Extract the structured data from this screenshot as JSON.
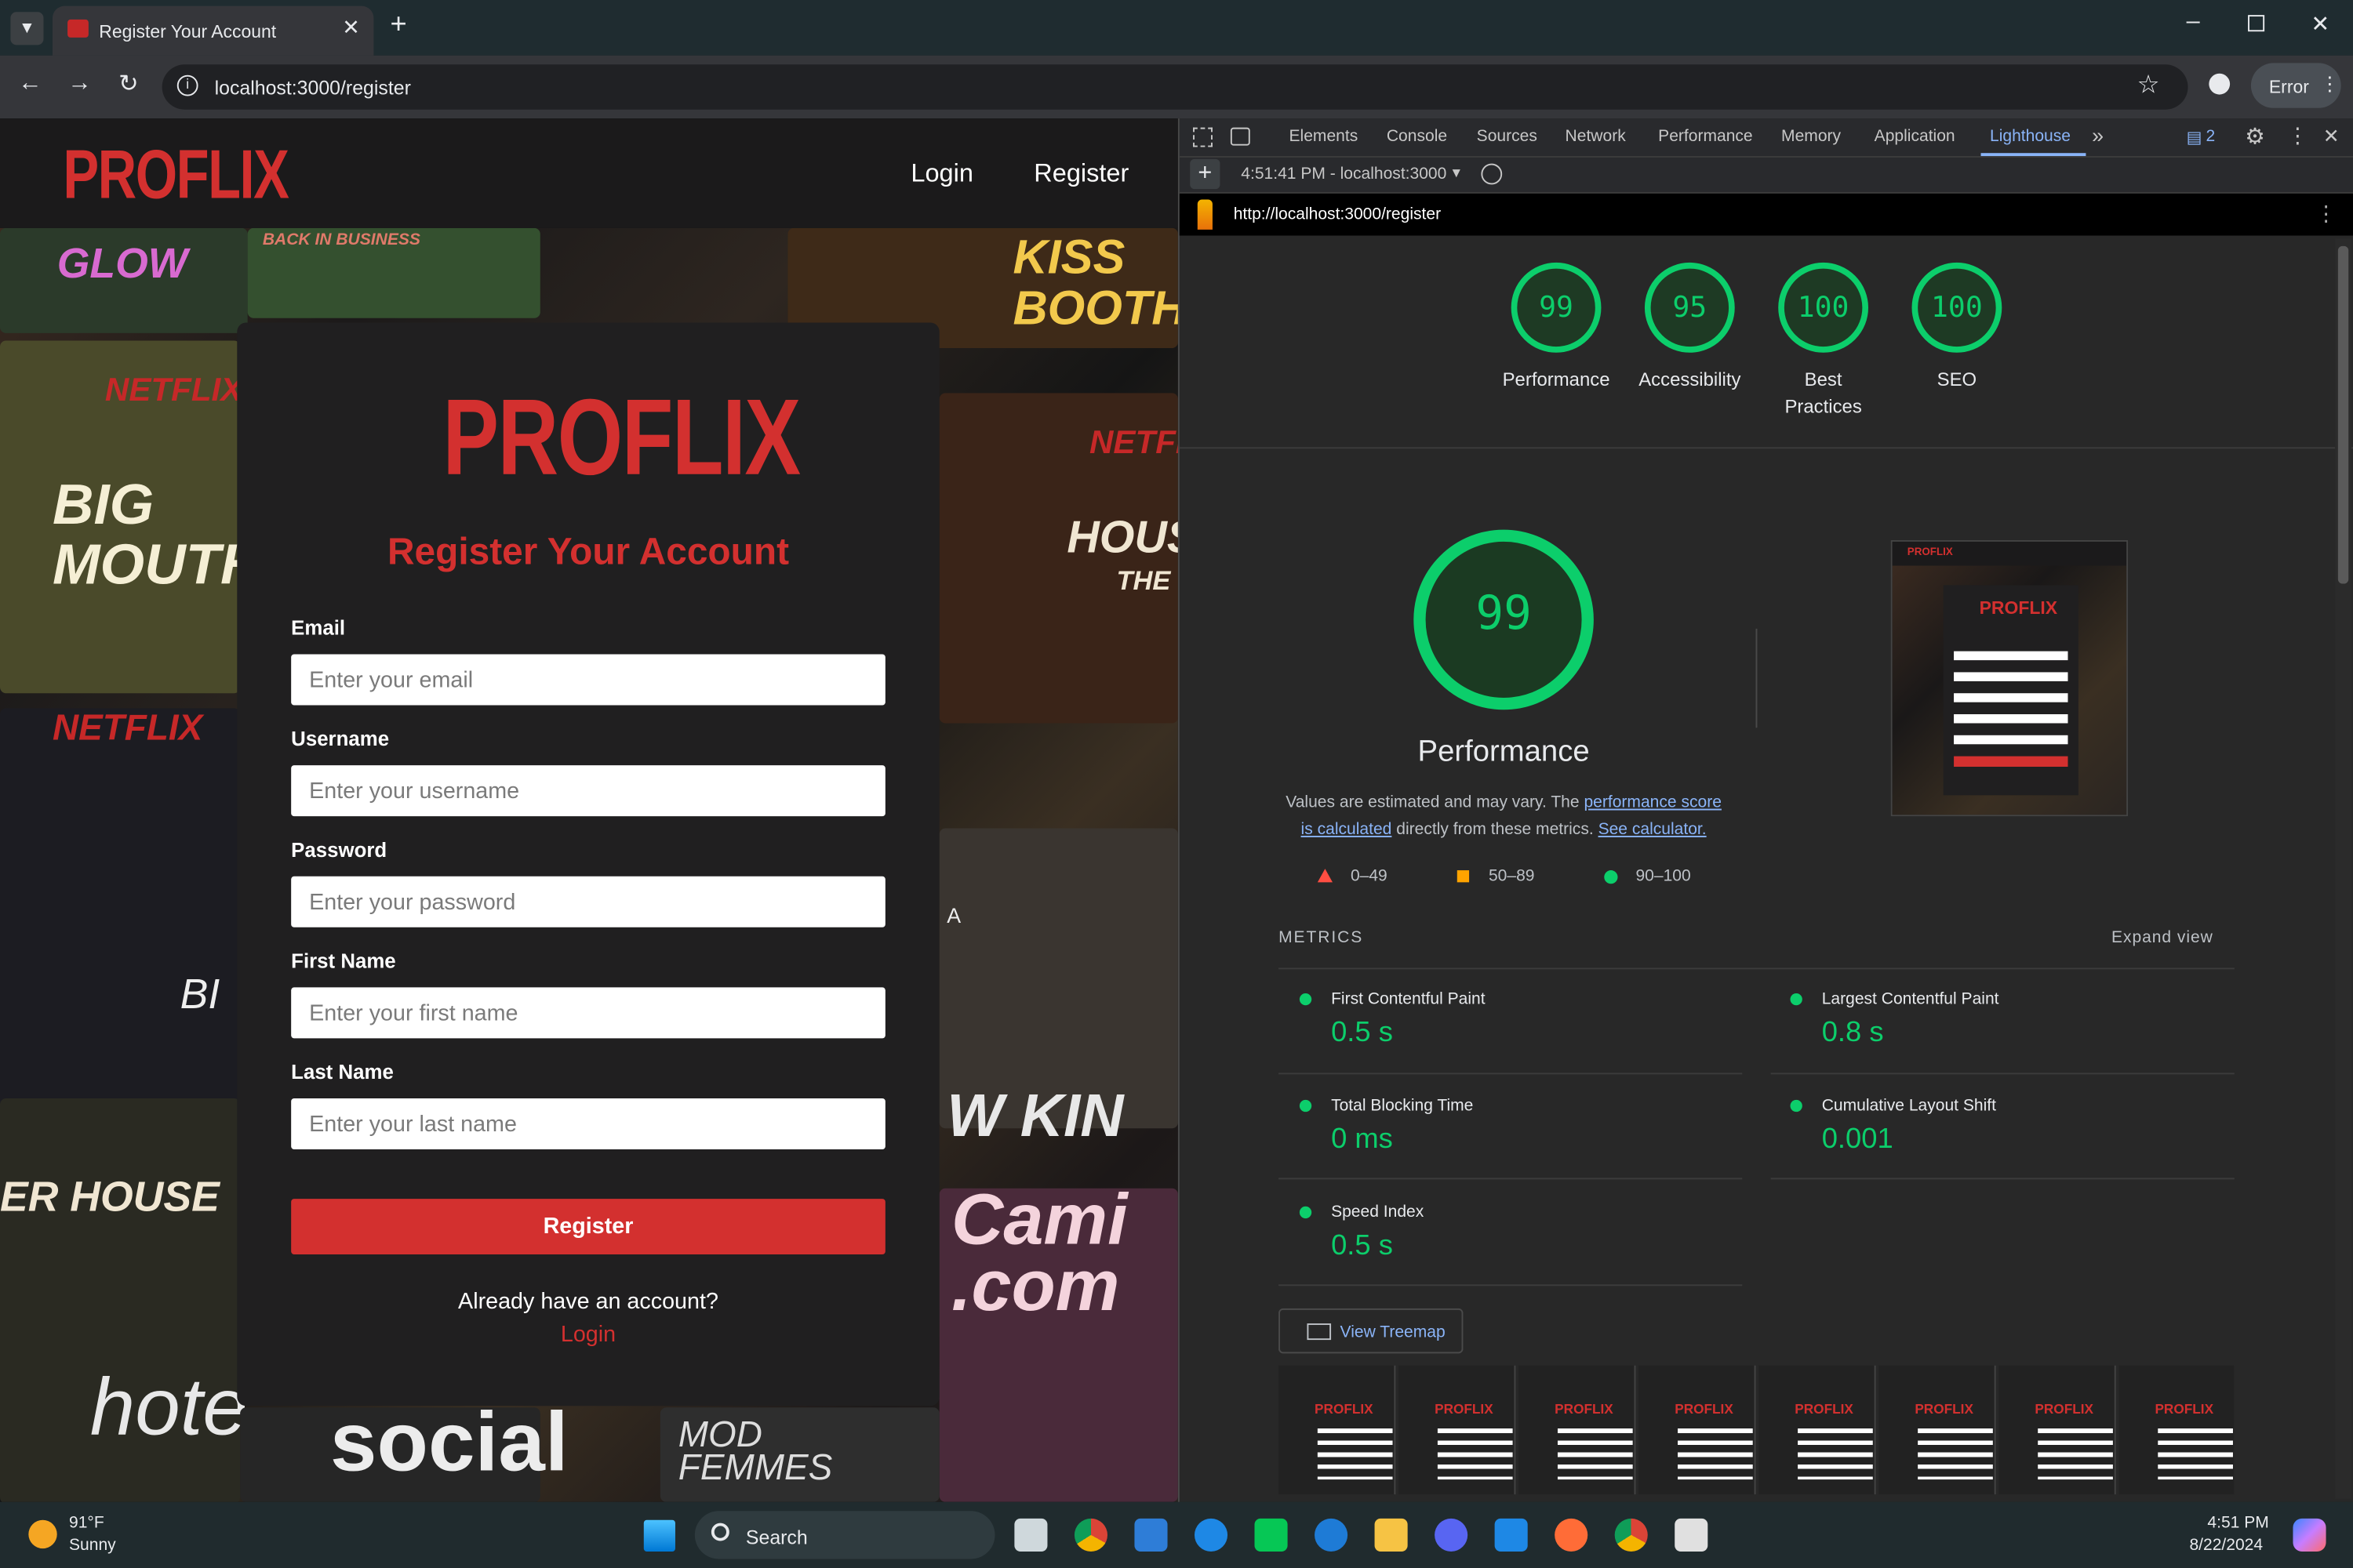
{
  "browser": {
    "tab_title": "Register Your Account",
    "url": "localhost:3000/register",
    "profile_label": "Error"
  },
  "site": {
    "brand": "PROFLIX",
    "nav": {
      "login": "Login",
      "register": "Register"
    },
    "form": {
      "heading": "Register Your Account",
      "fields": [
        {
          "label": "Email",
          "placeholder": "Enter your email"
        },
        {
          "label": "Username",
          "placeholder": "Enter your username"
        },
        {
          "label": "Password",
          "placeholder": "Enter your password"
        },
        {
          "label": "First Name",
          "placeholder": "Enter your first name"
        },
        {
          "label": "Last Name",
          "placeholder": "Enter your last name"
        }
      ],
      "submit": "Register",
      "footer_text": "Already have an account?",
      "footer_link": "Login"
    },
    "background_posters": [
      "GLOW",
      "BACK IN BUSINESS",
      "KISS BOOTH",
      "NETFLIX",
      "BIG MOUTH",
      "NETFLIX",
      "HOUSE",
      "THE",
      "NETFLIX",
      "ER HOUSE",
      "BI",
      "W KIN",
      "Cami .com",
      "hote",
      "social",
      "MOD FEMMES",
      "A"
    ]
  },
  "devtools": {
    "tabs": [
      "Elements",
      "Console",
      "Sources",
      "Network",
      "Performance",
      "Memory",
      "Application",
      "Lighthouse"
    ],
    "active_tab": "Lighthouse",
    "issues_count": "2",
    "report_selector": "4:51:41 PM - localhost:3000",
    "report_url": "http://localhost:3000/register",
    "scores": [
      {
        "value": "99",
        "label": "Performance"
      },
      {
        "value": "95",
        "label": "Accessibility"
      },
      {
        "value": "100",
        "label": "Best Practices"
      },
      {
        "value": "100",
        "label": "SEO"
      }
    ],
    "main_score": "99",
    "main_title": "Performance",
    "desc_1": "Values are estimated and may vary. The ",
    "desc_link_1": "performance score is calculated",
    "desc_2": " directly from these metrics. ",
    "desc_link_2": "See calculator.",
    "legend": [
      "0–49",
      "50–89",
      "90–100"
    ],
    "metrics_title": "METRICS",
    "expand_view": "Expand view",
    "metrics": [
      {
        "name": "First Contentful Paint",
        "value": "0.5 s"
      },
      {
        "name": "Largest Contentful Paint",
        "value": "0.8 s"
      },
      {
        "name": "Total Blocking Time",
        "value": "0 ms"
      },
      {
        "name": "Cumulative Layout Shift",
        "value": "0.001"
      },
      {
        "name": "Speed Index",
        "value": "0.5 s"
      }
    ],
    "treemap_button": "View Treemap",
    "filmstrip_label": "PROFLIX",
    "colors": {
      "pass": "#0cce6b",
      "average": "#ffa400",
      "fail": "#ff4e42",
      "link": "#8ab4f8"
    }
  },
  "taskbar": {
    "weather_temp": "91°F",
    "weather_desc": "Sunny",
    "search": "Search",
    "time": "4:51 PM",
    "date": "8/22/2024"
  }
}
